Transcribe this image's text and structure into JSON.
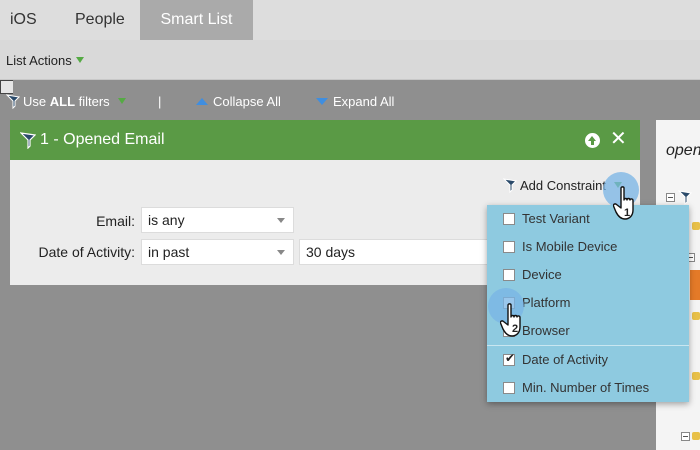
{
  "tabs": [
    {
      "label": "iOS",
      "active": false
    },
    {
      "label": "People",
      "active": false
    },
    {
      "label": "Smart List",
      "active": true
    }
  ],
  "actions_bar": {
    "list_actions_label": "List Actions"
  },
  "toolbar": {
    "use_prefix": "Use ",
    "use_bold": "ALL",
    "use_suffix": " filters",
    "separator": "|",
    "collapse_label": "Collapse All",
    "expand_label": "Expand All"
  },
  "filter": {
    "title": "1 - Opened Email",
    "add_constraint_label": "Add Constraint",
    "email_label": "Email:",
    "email_value": "is any",
    "doa_label": "Date of Activity:",
    "doa_operator": "in past",
    "doa_value": "30 days"
  },
  "right_panel": {
    "text": "open"
  },
  "dropdown": {
    "items": [
      {
        "label": "Test Variant",
        "checked": false
      },
      {
        "label": "Is Mobile Device",
        "checked": false
      },
      {
        "label": "Device",
        "checked": false
      },
      {
        "label": "Platform",
        "checked": false
      },
      {
        "label": "Browser",
        "checked": false
      },
      {
        "label": "Date of Activity",
        "checked": true
      },
      {
        "label": "Min. Number of Times",
        "checked": false
      }
    ]
  },
  "annotations": {
    "step1": "1",
    "step2": "2"
  },
  "colors": {
    "header_green": "#5a9a45",
    "dropdown_blue": "#8ecae0",
    "accent_blue": "#3f8ee0"
  }
}
